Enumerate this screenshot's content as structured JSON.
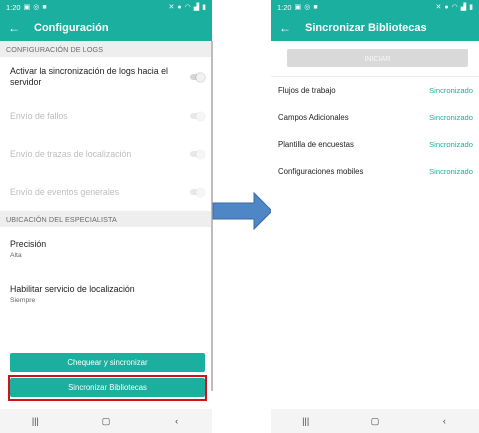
{
  "left": {
    "status": {
      "time": "1:20"
    },
    "appbar": {
      "title": "Configuración"
    },
    "sections": {
      "logs": "CONFIGURACIÓN DE LOGS",
      "location": "UBICACIÓN DEL ESPECIALISTA"
    },
    "log_items": [
      {
        "label": "Activar la sincronización de logs hacia el servidor",
        "enabled": true
      },
      {
        "label": "Envío de fallos",
        "enabled": false
      },
      {
        "label": "Envío de trazas de localización",
        "enabled": false
      },
      {
        "label": "Envío de eventos generales",
        "enabled": false
      }
    ],
    "location_items": [
      {
        "label": "Precisión",
        "value": "Alta"
      },
      {
        "label": "Habilitar servicio de localización",
        "value": "Siempre"
      }
    ],
    "buttons": {
      "check_sync": "Chequear y sincronizar",
      "sync_libraries": "Sincronizar Bibliotecas"
    },
    "highlight_color": "#d0121b"
  },
  "right": {
    "status": {
      "time": "1:20"
    },
    "appbar": {
      "title": "Sincronizar Bibliotecas"
    },
    "start_button": "INICIAR",
    "libraries": [
      {
        "name": "Flujos de trabajo",
        "status": "Sincronizado"
      },
      {
        "name": "Campos Adicionales",
        "status": "Sincronizado"
      },
      {
        "name": "Plantilla de encuestas",
        "status": "Sincronizado"
      },
      {
        "name": "Configuraciones mobiles",
        "status": "Sincronizado"
      }
    ]
  },
  "theme": {
    "accent": "#1aaf9f",
    "arrow": "#4f86c6"
  },
  "nav_icons": [
    "recents-icon",
    "home-icon",
    "back-icon"
  ]
}
